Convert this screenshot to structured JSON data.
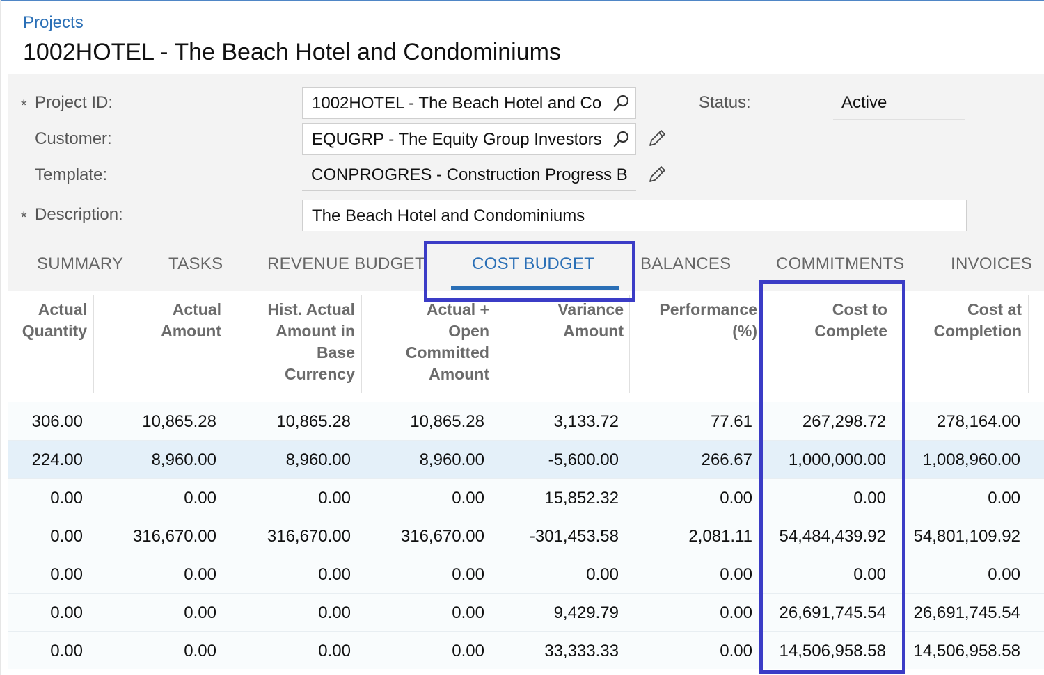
{
  "breadcrumb": "Projects",
  "title": "1002HOTEL - The Beach Hotel and Condominiums",
  "form": {
    "project_id": {
      "label": "Project ID:",
      "value": "1002HOTEL - The Beach Hotel and Co"
    },
    "customer": {
      "label": "Customer:",
      "value": "EQUGRP - The Equity Group Investors"
    },
    "template": {
      "label": "Template:",
      "value": "CONPROGRES - Construction Progress B"
    },
    "description": {
      "label": "Description:",
      "value": "The Beach Hotel and Condominiums"
    },
    "status": {
      "label": "Status:",
      "value": "Active"
    },
    "required_mark": "*"
  },
  "tabs": [
    "SUMMARY",
    "TASKS",
    "REVENUE BUDGET",
    "COST BUDGET",
    "BALANCES",
    "COMMITMENTS",
    "INVOICES"
  ],
  "active_tab": "COST BUDGET",
  "grid": {
    "columns": [
      [
        "Actual",
        "Quantity"
      ],
      [
        "Actual",
        "Amount"
      ],
      [
        "Hist. Actual",
        "Amount in",
        "Base",
        "Currency"
      ],
      [
        "Actual +",
        "Open",
        "Committed",
        "Amount"
      ],
      [
        "Variance",
        "Amount"
      ],
      [
        "Performance",
        "(%)"
      ],
      [
        "Cost to",
        "Complete"
      ],
      [
        "Cost at",
        "Completion"
      ]
    ],
    "rows": [
      [
        "306.00",
        "10,865.28",
        "10,865.28",
        "10,865.28",
        "3,133.72",
        "77.61",
        "267,298.72",
        "278,164.00"
      ],
      [
        "224.00",
        "8,960.00",
        "8,960.00",
        "8,960.00",
        "-5,600.00",
        "266.67",
        "1,000,000.00",
        "1,008,960.00"
      ],
      [
        "0.00",
        "0.00",
        "0.00",
        "0.00",
        "15,852.32",
        "0.00",
        "0.00",
        "0.00"
      ],
      [
        "0.00",
        "316,670.00",
        "316,670.00",
        "316,670.00",
        "-301,453.58",
        "2,081.11",
        "54,484,439.92",
        "54,801,109.92"
      ],
      [
        "0.00",
        "0.00",
        "0.00",
        "0.00",
        "0.00",
        "0.00",
        "0.00",
        "0.00"
      ],
      [
        "0.00",
        "0.00",
        "0.00",
        "0.00",
        "9,429.79",
        "0.00",
        "26,691,745.54",
        "26,691,745.54"
      ],
      [
        "0.00",
        "0.00",
        "0.00",
        "0.00",
        "33,333.33",
        "0.00",
        "14,506,958.58",
        "14,506,958.58"
      ]
    ],
    "selected_row": 1
  },
  "colors": {
    "accent": "#2a6fb6",
    "highlight": "#3b3cc6",
    "selected_row": "#e4f0f9"
  },
  "icons": {
    "lookup": "search-icon",
    "edit": "pencil-icon"
  }
}
